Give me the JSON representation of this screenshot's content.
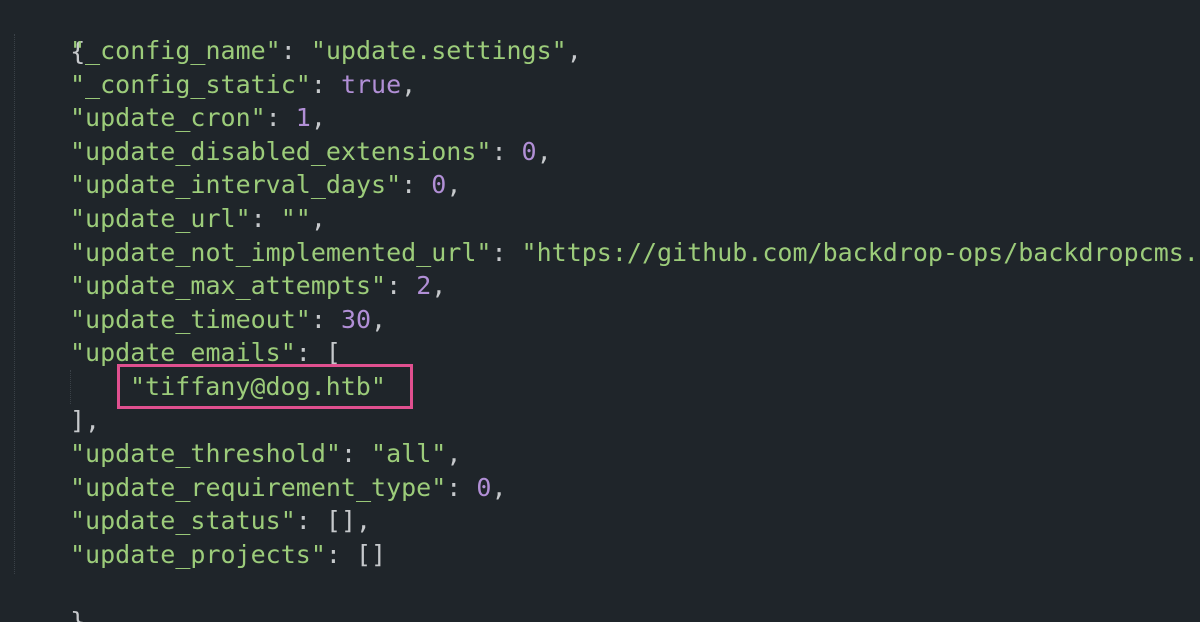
{
  "editor": {
    "open_brace": "{",
    "close_brace": "}",
    "colors": {
      "background": "#1f252a",
      "string": "#9ccc7a",
      "number": "#b18fd6",
      "punctuation": "#c6c9cc",
      "highlight": "#e0508f"
    },
    "lines": [
      {
        "key": "\"_config_name\"",
        "sep": ": ",
        "value": "\"update.settings\"",
        "type": "str",
        "trail": ","
      },
      {
        "key": "\"_config_static\"",
        "sep": ": ",
        "value": "true",
        "type": "bool",
        "trail": ","
      },
      {
        "key": "\"update_cron\"",
        "sep": ": ",
        "value": "1",
        "type": "num",
        "trail": ","
      },
      {
        "key": "\"update_disabled_extensions\"",
        "sep": ": ",
        "value": "0",
        "type": "num",
        "trail": ","
      },
      {
        "key": "\"update_interval_days\"",
        "sep": ": ",
        "value": "0",
        "type": "num",
        "trail": ","
      },
      {
        "key": "\"update_url\"",
        "sep": ": ",
        "value": "\"\"",
        "type": "str",
        "trail": ","
      },
      {
        "key": "\"update_not_implemented_url\"",
        "sep": ": ",
        "value": "\"https://github.com/backdrop-ops/backdropcms.o",
        "type": "str",
        "trail": ""
      },
      {
        "key": "\"update_max_attempts\"",
        "sep": ": ",
        "value": "2",
        "type": "num",
        "trail": ","
      },
      {
        "key": "\"update_timeout\"",
        "sep": ": ",
        "value": "30",
        "type": "num",
        "trail": ","
      },
      {
        "key": "\"update_emails\"",
        "sep": ": ",
        "value": "[",
        "type": "punc",
        "trail": ""
      },
      {
        "key": "",
        "sep": "",
        "value": "\"tiffany@dog.htb\"",
        "type": "str",
        "trail": "",
        "nested": true
      },
      {
        "key": "",
        "sep": "",
        "value": "],",
        "type": "punc",
        "trail": ""
      },
      {
        "key": "\"update_threshold\"",
        "sep": ": ",
        "value": "\"all\"",
        "type": "str",
        "trail": ","
      },
      {
        "key": "\"update_requirement_type\"",
        "sep": ": ",
        "value": "0",
        "type": "num",
        "trail": ","
      },
      {
        "key": "\"update_status\"",
        "sep": ": ",
        "value": "[]",
        "type": "punc",
        "trail": ","
      },
      {
        "key": "\"update_projects\"",
        "sep": ": ",
        "value": "[]",
        "type": "punc",
        "trail": ""
      }
    ]
  }
}
